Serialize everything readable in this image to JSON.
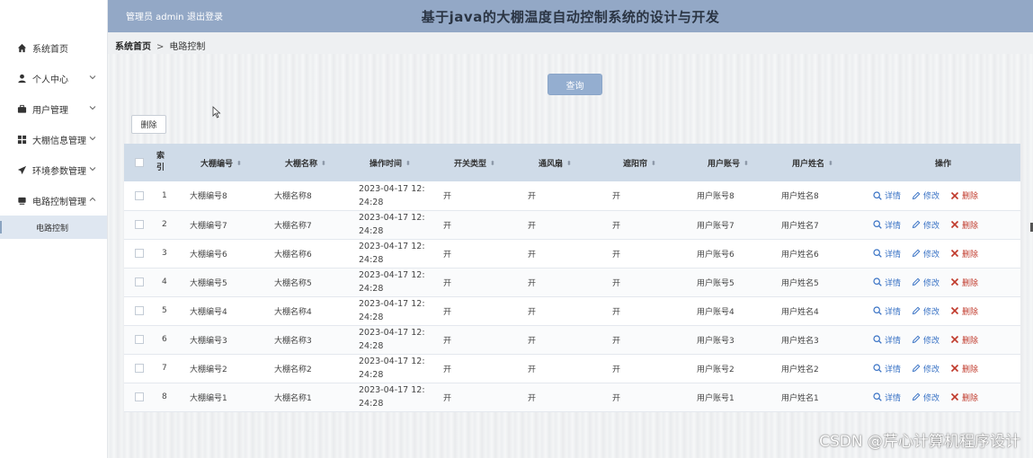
{
  "header": {
    "admin_text": "管理员 admin",
    "logout_label": "退出登录",
    "title": "基于java的大棚温度自动控制系统的设计与开发"
  },
  "sidebar": {
    "items": [
      {
        "label": "系统首页",
        "icon": "home-icon"
      },
      {
        "label": "个人中心",
        "icon": "user-icon"
      },
      {
        "label": "用户管理",
        "icon": "briefcase-icon"
      },
      {
        "label": "大棚信息管理",
        "icon": "grid-icon"
      },
      {
        "label": "环境参数管理",
        "icon": "send-icon"
      },
      {
        "label": "电路控制管理",
        "icon": "device-icon"
      }
    ],
    "sub_item": "电路控制"
  },
  "breadcrumb": {
    "home": "系统首页",
    "separator": ">",
    "current": "电路控制"
  },
  "toolbar": {
    "query_label": "查询",
    "delete_label": "删除"
  },
  "table": {
    "headers": {
      "index": "索引",
      "greenhouse_no": "大棚编号",
      "greenhouse_name": "大棚名称",
      "op_time": "操作时间",
      "switch_type": "开关类型",
      "ventilator": "通风扇",
      "sunshade": "遮阳帘",
      "user_account": "用户账号",
      "user_name": "用户姓名",
      "actions": "操作"
    },
    "actions": {
      "detail": "详情",
      "edit": "修改",
      "delete": "删除"
    },
    "rows": [
      {
        "index": "1",
        "no": "大棚编号8",
        "name": "大棚名称8",
        "time": "2023-04-17 12:24:28",
        "switch": "开",
        "fan": "开",
        "shade": "开",
        "account": "用户账号8",
        "uname": "用户姓名8"
      },
      {
        "index": "2",
        "no": "大棚编号7",
        "name": "大棚名称7",
        "time": "2023-04-17 12:24:28",
        "switch": "开",
        "fan": "开",
        "shade": "开",
        "account": "用户账号7",
        "uname": "用户姓名7"
      },
      {
        "index": "3",
        "no": "大棚编号6",
        "name": "大棚名称6",
        "time": "2023-04-17 12:24:28",
        "switch": "开",
        "fan": "开",
        "shade": "开",
        "account": "用户账号6",
        "uname": "用户姓名6"
      },
      {
        "index": "4",
        "no": "大棚编号5",
        "name": "大棚名称5",
        "time": "2023-04-17 12:24:28",
        "switch": "开",
        "fan": "开",
        "shade": "开",
        "account": "用户账号5",
        "uname": "用户姓名5"
      },
      {
        "index": "5",
        "no": "大棚编号4",
        "name": "大棚名称4",
        "time": "2023-04-17 12:24:28",
        "switch": "开",
        "fan": "开",
        "shade": "开",
        "account": "用户账号4",
        "uname": "用户姓名4"
      },
      {
        "index": "6",
        "no": "大棚编号3",
        "name": "大棚名称3",
        "time": "2023-04-17 12:24:28",
        "switch": "开",
        "fan": "开",
        "shade": "开",
        "account": "用户账号3",
        "uname": "用户姓名3"
      },
      {
        "index": "7",
        "no": "大棚编号2",
        "name": "大棚名称2",
        "time": "2023-04-17 12:24:28",
        "switch": "开",
        "fan": "开",
        "shade": "开",
        "account": "用户账号2",
        "uname": "用户姓名2"
      },
      {
        "index": "8",
        "no": "大棚编号1",
        "name": "大棚名称1",
        "time": "2023-04-17 12:24:28",
        "switch": "开",
        "fan": "开",
        "shade": "开",
        "account": "用户账号1",
        "uname": "用户姓名1"
      }
    ]
  },
  "watermark": "CSDN @芹心计算机程序设计"
}
